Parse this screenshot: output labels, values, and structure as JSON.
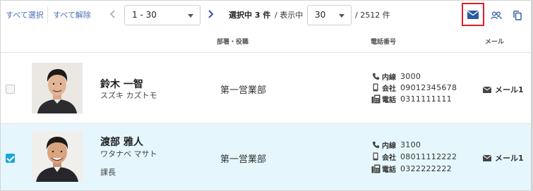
{
  "toolbar": {
    "select_all": "すべて選択",
    "deselect_all": "すべて解除",
    "page_range": "1 - 30",
    "selected_text": "選択中 3 件",
    "showing_label": "/ 表示中",
    "per_page": "30",
    "total_text": "/ 2512 件",
    "icons": [
      "mail-icon",
      "group-icon",
      "copy-icon"
    ],
    "highlight_color": "#d9202a",
    "accent_color": "#2c5aa0"
  },
  "columns": {
    "dept_title": "部署・役職",
    "phone": "電話番号",
    "mail": "メール"
  },
  "rows": [
    {
      "checked": false,
      "name": "鈴木 一智",
      "kana": "スズキ カズトモ",
      "title": "",
      "dept": "第一営業部",
      "phones": [
        {
          "icon": "phone-icon",
          "label": "内線",
          "value": "3000"
        },
        {
          "icon": "mobile-icon",
          "label": "会社",
          "value": "09012345678"
        },
        {
          "icon": "fax-icon",
          "label": "電話",
          "value": "0311111111"
        }
      ],
      "mail": "メール1"
    },
    {
      "checked": true,
      "name": "渡部 雅人",
      "kana": "ワタナベ マサト",
      "title": "課長",
      "dept": "第一営業部",
      "phones": [
        {
          "icon": "phone-icon",
          "label": "内線",
          "value": "3100"
        },
        {
          "icon": "mobile-icon",
          "label": "会社",
          "value": "08011112222"
        },
        {
          "icon": "fax-icon",
          "label": "電話",
          "value": "0322222222"
        }
      ],
      "mail": "メール1"
    }
  ],
  "colors": {
    "selected_row_bg": "#e5f7fc",
    "checkbox_checked": "#1aa7d8"
  }
}
